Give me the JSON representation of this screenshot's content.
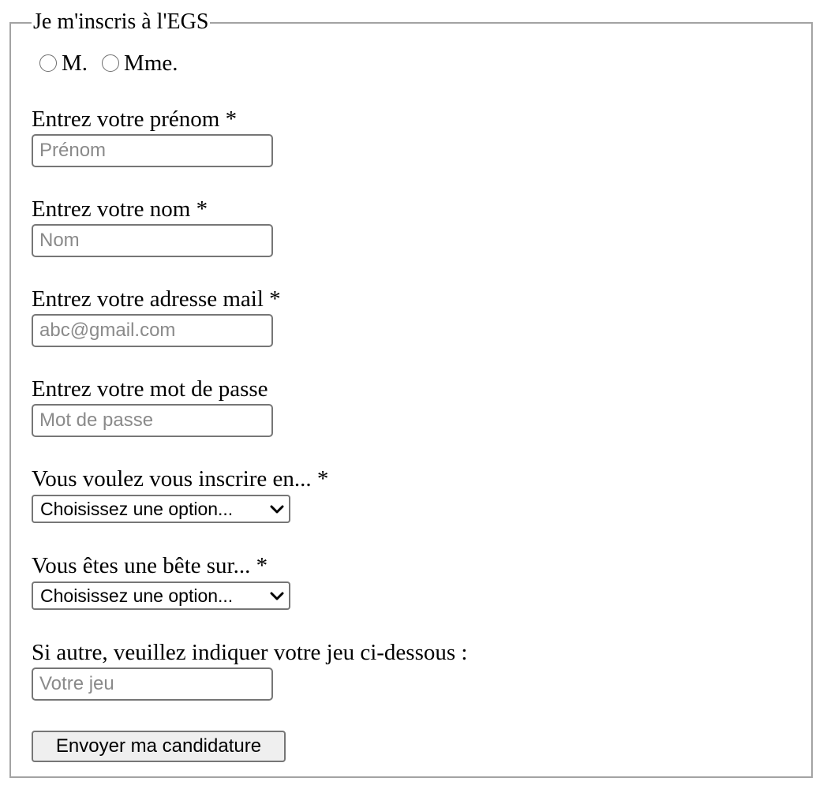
{
  "form": {
    "legend": "Je m'inscris à l'EGS",
    "civility": [
      {
        "label": "M."
      },
      {
        "label": "Mme."
      }
    ],
    "firstname": {
      "label": "Entrez votre prénom *",
      "placeholder": "Prénom",
      "value": ""
    },
    "lastname": {
      "label": "Entrez votre nom *",
      "placeholder": "Nom",
      "value": ""
    },
    "email": {
      "label": "Entrez votre adresse mail *",
      "placeholder": "abc@gmail.com",
      "value": ""
    },
    "password": {
      "label": "Entrez votre mot de passe",
      "placeholder": "Mot de passe",
      "value": ""
    },
    "enrollment": {
      "label": "Vous voulez vous inscrire en... *",
      "selected": "Choisissez une option..."
    },
    "specialty": {
      "label": "Vous êtes une bête sur... *",
      "selected": "Choisissez une option..."
    },
    "other_game": {
      "label": "Si autre, veuillez indiquer votre jeu ci-dessous :",
      "placeholder": "Votre jeu",
      "value": ""
    },
    "submit_label": "Envoyer ma candidature"
  },
  "icons": {
    "select_arrow": "chevron-down-icon"
  }
}
